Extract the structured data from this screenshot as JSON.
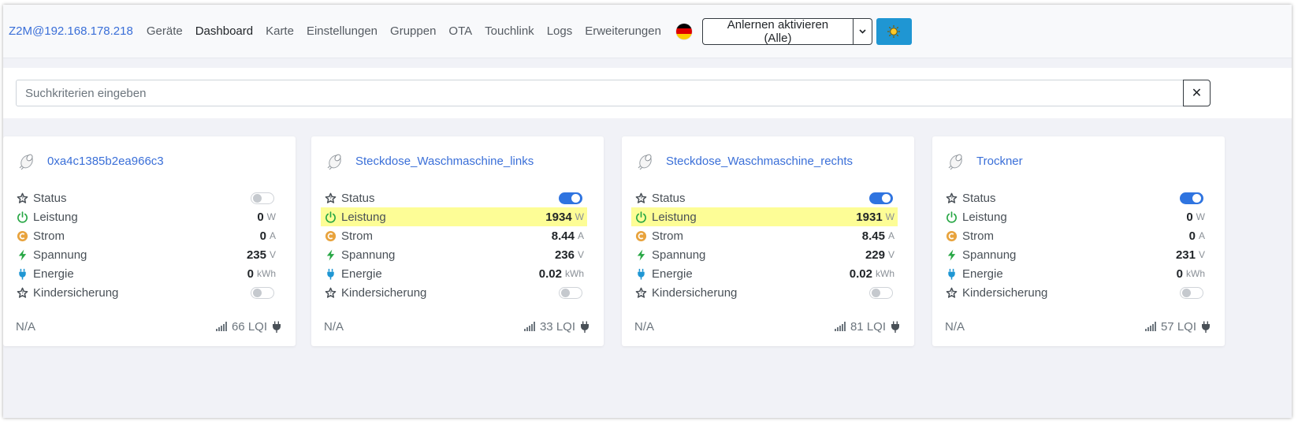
{
  "nav": {
    "brand": "Z2M@192.168.178.218",
    "links": [
      {
        "label": "Geräte",
        "active": false
      },
      {
        "label": "Dashboard",
        "active": true
      },
      {
        "label": "Karte",
        "active": false
      },
      {
        "label": "Einstellungen",
        "active": false
      },
      {
        "label": "Gruppen",
        "active": false
      },
      {
        "label": "OTA",
        "active": false
      },
      {
        "label": "Touchlink",
        "active": false
      },
      {
        "label": "Logs",
        "active": false
      },
      {
        "label": "Erweiterungen",
        "active": false
      }
    ],
    "language_icon": "german-flag-icon",
    "permit_join_label": "Anlernen aktivieren (Alle)",
    "caret_icon": "chevron-down-icon",
    "theme_icon": "sun-icon"
  },
  "search": {
    "placeholder": "Suchkriterien eingeben",
    "clear_label": "✕"
  },
  "labels": {
    "status": "Status",
    "power": "Leistung",
    "current": "Strom",
    "voltage": "Spannung",
    "energy": "Energie",
    "child_lock": "Kindersicherung"
  },
  "units": {
    "power": "W",
    "current": "A",
    "voltage": "V",
    "energy": "kWh"
  },
  "devices": [
    {
      "name": "0xa4c1385b2ea966c3",
      "status_on": false,
      "power": "0",
      "power_highlight": false,
      "current": "0",
      "voltage": "235",
      "energy": "0",
      "child_lock_on": false,
      "last_seen": "N/A",
      "lqi": "66 LQI"
    },
    {
      "name": "Steckdose_Waschmaschine_links",
      "status_on": true,
      "power": "1934",
      "power_highlight": true,
      "current": "8.44",
      "voltage": "236",
      "energy": "0.02",
      "child_lock_on": false,
      "last_seen": "N/A",
      "lqi": "33 LQI"
    },
    {
      "name": "Steckdose_Waschmaschine_rechts",
      "status_on": true,
      "power": "1931",
      "power_highlight": true,
      "current": "8.45",
      "voltage": "229",
      "energy": "0.02",
      "child_lock_on": false,
      "last_seen": "N/A",
      "lqi": "81 LQI"
    },
    {
      "name": "Trockner",
      "status_on": true,
      "power": "0",
      "power_highlight": false,
      "current": "0",
      "voltage": "231",
      "energy": "0",
      "child_lock_on": false,
      "last_seen": "N/A",
      "lqi": "57 LQI"
    }
  ],
  "colors": {
    "link": "#3a6fd8",
    "toggle_on": "#2f74e0",
    "theme_button": "#1f96d3",
    "highlight": "#fdfd96",
    "power_icon": "#28a745",
    "current_icon": "#e8a33d",
    "voltage_icon": "#28a745",
    "energy_icon": "#1f96d3"
  }
}
